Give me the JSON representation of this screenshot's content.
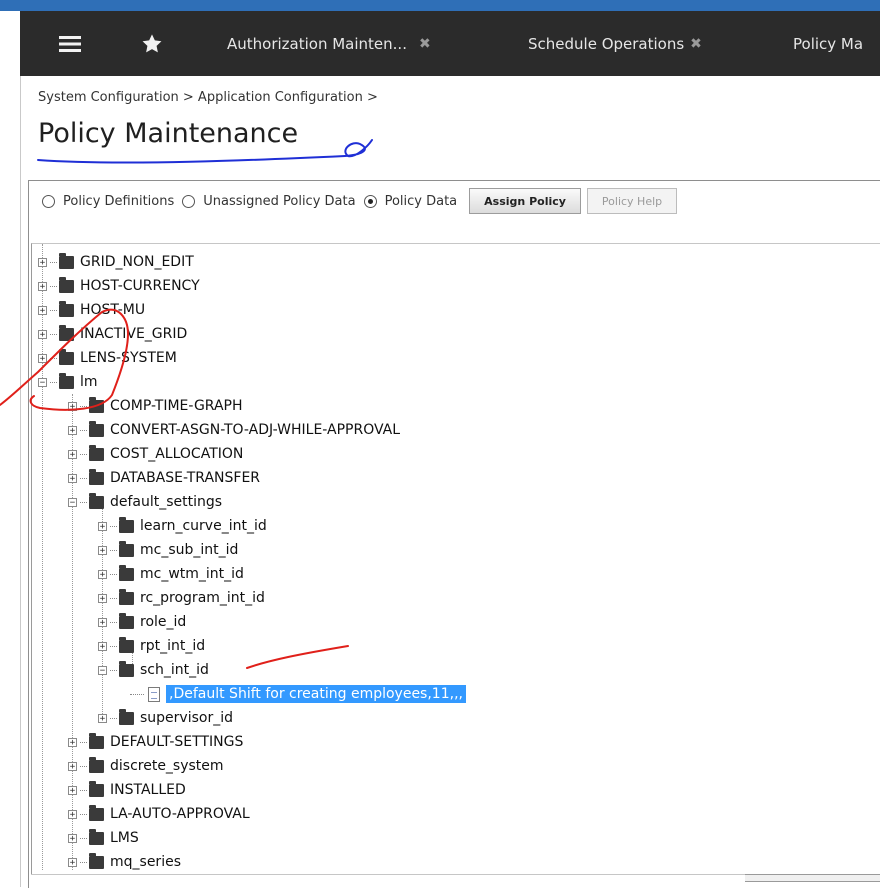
{
  "tabs": [
    {
      "label": "Authorization Mainten...",
      "closable": true,
      "active": false
    },
    {
      "label": "Schedule Operations",
      "closable": true,
      "active": false
    },
    {
      "label": "Policy Ma",
      "closable": false,
      "active": true
    }
  ],
  "icons": {
    "menu": "hamburger-icon",
    "favorite": "star-icon",
    "close": "close-icon",
    "folder": "folder-icon",
    "document": "document-icon"
  },
  "breadcrumb": "System Configuration > Application Configuration >",
  "page_title": "Policy Maintenance",
  "toolbar": {
    "radio_options": [
      {
        "label": "Policy Definitions",
        "selected": false
      },
      {
        "label": "Unassigned Policy Data",
        "selected": false
      },
      {
        "label": "Policy Data",
        "selected": true
      }
    ],
    "assign_policy_label": "Assign Policy",
    "policy_help_label": "Policy Help"
  },
  "tree": {
    "nodes": [
      "GRID_NON_EDIT",
      "HOST-CURRENCY",
      "HOST-MU",
      "INACTIVE_GRID",
      "LENS-SYSTEM",
      "lm",
      "COMP-TIME-GRAPH",
      "CONVERT-ASGN-TO-ADJ-WHILE-APPROVAL",
      "COST_ALLOCATION",
      "DATABASE-TRANSFER",
      "default_settings",
      "learn_curve_int_id",
      "mc_sub_int_id",
      "mc_wtm_int_id",
      "rc_program_int_id",
      "role_id",
      "rpt_int_id",
      "sch_int_id",
      ",Default Shift for creating employees,11,,,",
      "supervisor_id",
      "DEFAULT-SETTINGS",
      "discrete_system",
      "INSTALLED",
      "LA-AUTO-APPROVAL",
      "LMS",
      "mq_series"
    ]
  },
  "colors": {
    "tab_bar": "#2b2b2b",
    "top_strip": "#2f6fb7",
    "selection": "#3399ff",
    "annotation_blue": "#1f2fd6",
    "annotation_red": "#e0201a"
  }
}
